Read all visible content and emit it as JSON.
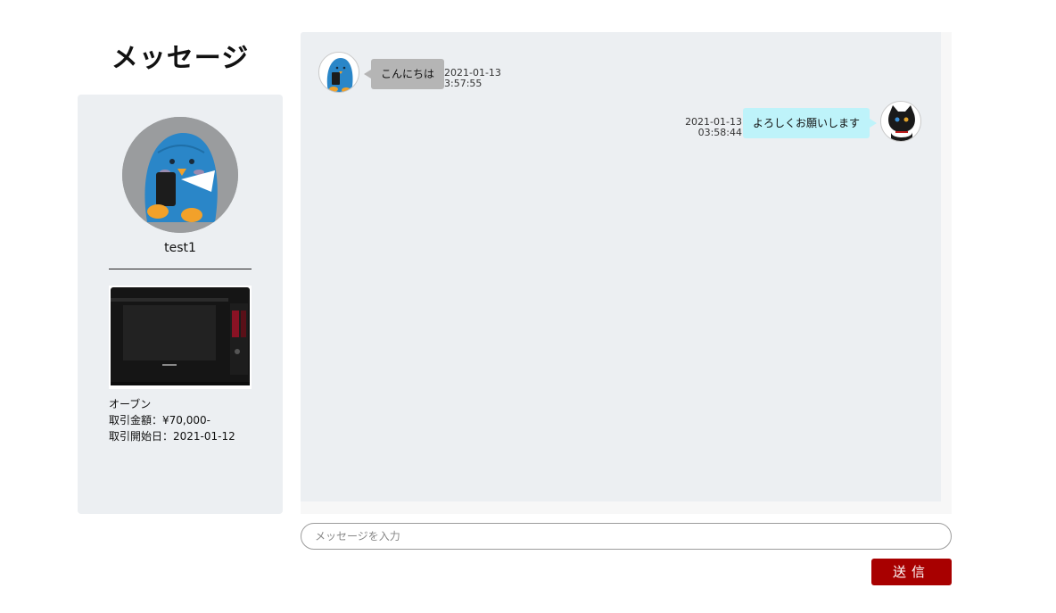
{
  "page": {
    "title": "メッセージ"
  },
  "partner": {
    "name": "test1"
  },
  "item": {
    "name": "オーブン",
    "price_line": "取引金額：¥70,000-",
    "start_line": "取引開始日：2021-01-12"
  },
  "messages": [
    {
      "side": "left",
      "text": "こんにちは",
      "date": "2021-01-13",
      "time": "3:57:55",
      "avatar_icon": "blue-penguin-avatar-icon"
    },
    {
      "side": "right",
      "text": "よろしくお願いします",
      "date": "2021-01-13",
      "time": "03:58:44",
      "avatar_icon": "black-cat-avatar-icon"
    }
  ],
  "composer": {
    "placeholder": "メッセージを入力",
    "value": ""
  },
  "send_button": {
    "label": "送信"
  },
  "colors": {
    "panel_bg": "#eceff2",
    "send_button": "#a80000",
    "own_bubble": "#bef3fa",
    "other_bubble": "#b5b5b5"
  }
}
